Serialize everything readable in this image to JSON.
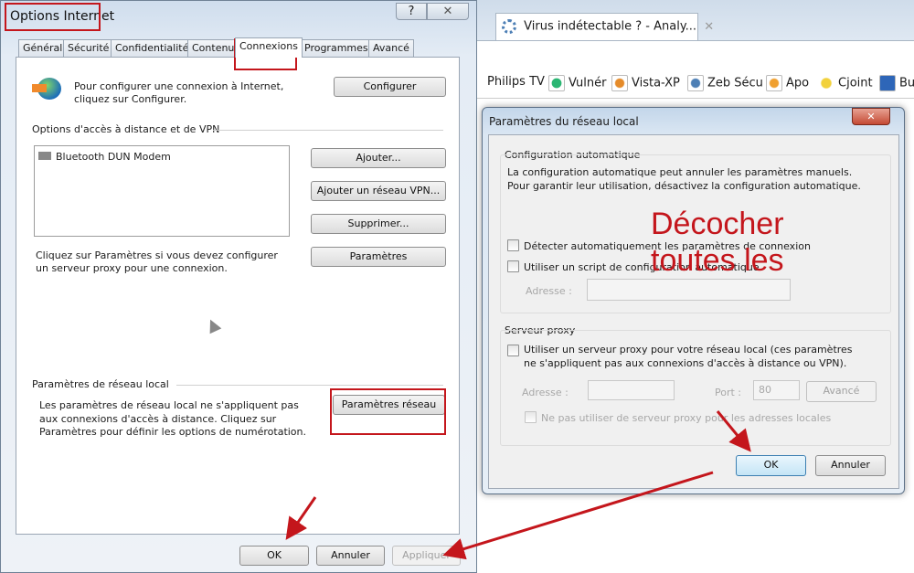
{
  "left_dialog": {
    "title": "Options Internet",
    "help_icon": "question-icon",
    "close_icon": "close-icon",
    "tabs": [
      "Général",
      "Sécurité",
      "Confidentialité",
      "Contenu",
      "Connexions",
      "Programmes",
      "Avancé"
    ],
    "active_tab": "Connexions",
    "setup_text": "Pour configurer une connexion à Internet, cliquez sur Configurer.",
    "configure_button": "Configurer",
    "dialup_group": "Options d'accès à distance et de VPN",
    "dialup_list": [
      "Bluetooth DUN Modem"
    ],
    "add_button": "Ajouter...",
    "add_vpn_button": "Ajouter un réseau VPN...",
    "remove_button": "Supprimer...",
    "settings_button": "Paramètres",
    "proxy_text": "Cliquez sur Paramètres si vous devez configurer un serveur proxy pour une connexion.",
    "lan_group": "Paramètres de réseau local",
    "lan_text": "Les paramètres de réseau local ne s'appliquent pas aux connexions d'accès à distance. Cliquez sur Paramètres pour définir les options de numérotation.",
    "lan_button": "Paramètres réseau",
    "ok": "OK",
    "cancel": "Annuler",
    "apply": "Appliquer"
  },
  "browser": {
    "tab_title": "Virus indétectable ? - Analy...",
    "bookmarks": [
      "Philips TV",
      "Vulnér",
      "Vista-XP",
      "Zeb Sécu",
      "Apo",
      "Cjoint",
      "Bu"
    ]
  },
  "lan_dialog": {
    "title": "Paramètres du réseau local",
    "auto_group": "Configuration automatique",
    "auto_text": "La configuration automatique peut annuler les paramètres manuels. Pour garantir leur utilisation, désactivez la configuration automatique.",
    "auto_detect": {
      "label": "Détecter automatiquement les paramètres de connexion",
      "checked": false
    },
    "auto_script": {
      "label": "Utiliser un script de configuration automatique",
      "checked": false
    },
    "address_label": "Adresse :",
    "proxy_group": "Serveur proxy",
    "use_proxy": {
      "label": "Utiliser un serveur proxy pour votre réseau local (ces paramètres ne s'appliquent pas aux connexions d'accès à distance ou VPN).",
      "checked": false
    },
    "proxy_address_label": "Adresse :",
    "port_label": "Port :",
    "port_value": "80",
    "advanced_button": "Avancé",
    "bypass_local": {
      "label": "Ne pas utiliser de serveur proxy pour les adresses locales",
      "checked": false
    },
    "ok": "OK",
    "cancel": "Annuler"
  },
  "annotation": {
    "line1": "Décocher",
    "line2": "toutes les",
    "color": "#c4161c"
  }
}
